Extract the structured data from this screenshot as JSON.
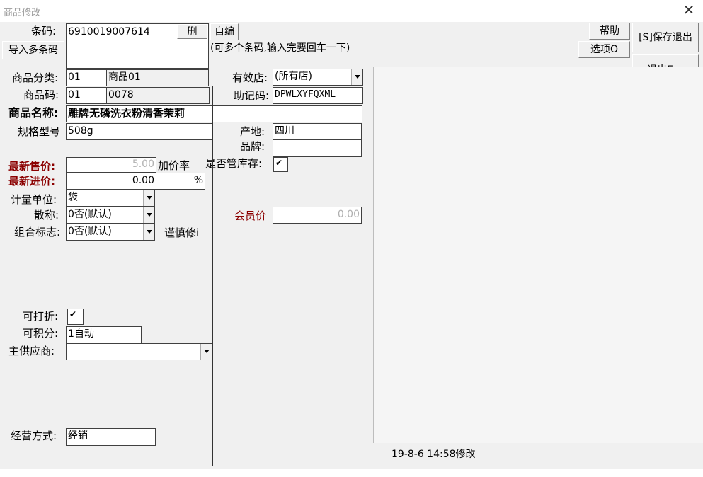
{
  "window": {
    "title": "商品修改",
    "close_glyph": "✕"
  },
  "barcode": {
    "label": "条码:",
    "value": "6910019007614",
    "delete_button": "删",
    "auto_button": "自编",
    "import_button": "导入多条码",
    "hint": "(可多个条码,输入完要回车一下)"
  },
  "buttons": {
    "help": "帮助",
    "options": "选项O",
    "save_exit": "[S]保存退出",
    "exit": "退出Esc"
  },
  "category": {
    "label": "商品分类:",
    "code": "01",
    "name": "商品01"
  },
  "store": {
    "label": "有效店:",
    "value": "(所有店)"
  },
  "product_code": {
    "label": "商品码:",
    "prefix": "01",
    "value": "0078"
  },
  "mnemonic": {
    "label": "助记码:",
    "value": "DPWLXYFQXML"
  },
  "product_name": {
    "label": "商品名称:",
    "value": "雕牌无磷洗衣粉清香茉莉"
  },
  "spec": {
    "label": "规格型号",
    "value": "508g"
  },
  "origin": {
    "label": "产地:",
    "value": "四川"
  },
  "brand": {
    "label": "品牌:",
    "value": ""
  },
  "sale_price": {
    "label": "最新售价:",
    "value": "5.00"
  },
  "markup": {
    "label": "加价率",
    "value": "",
    "unit": "%"
  },
  "purchase_price": {
    "label": "最新进价:",
    "value": "0.00"
  },
  "manage_stock": {
    "label": "是否管库存:",
    "checked": true
  },
  "unit": {
    "label": "计量单位:",
    "value": "袋"
  },
  "bulk": {
    "label": "散称:",
    "value": "0否(默认)"
  },
  "combo": {
    "label": "组合标志:",
    "value": "0否(默认)",
    "note": "谨慎修i"
  },
  "member_price": {
    "label": "会员价",
    "value": "0.00"
  },
  "discountable": {
    "label": "可打折:",
    "checked": true
  },
  "points": {
    "label": "可积分:",
    "value": "1自动"
  },
  "supplier": {
    "label": "主供应商:",
    "value": ""
  },
  "business_mode": {
    "label": "经营方式:",
    "value": "经销"
  },
  "status": {
    "modified": "19-8-6 14:58修改"
  },
  "colors": {
    "red_label": "#8b0000",
    "background": "#f0f0f0"
  }
}
